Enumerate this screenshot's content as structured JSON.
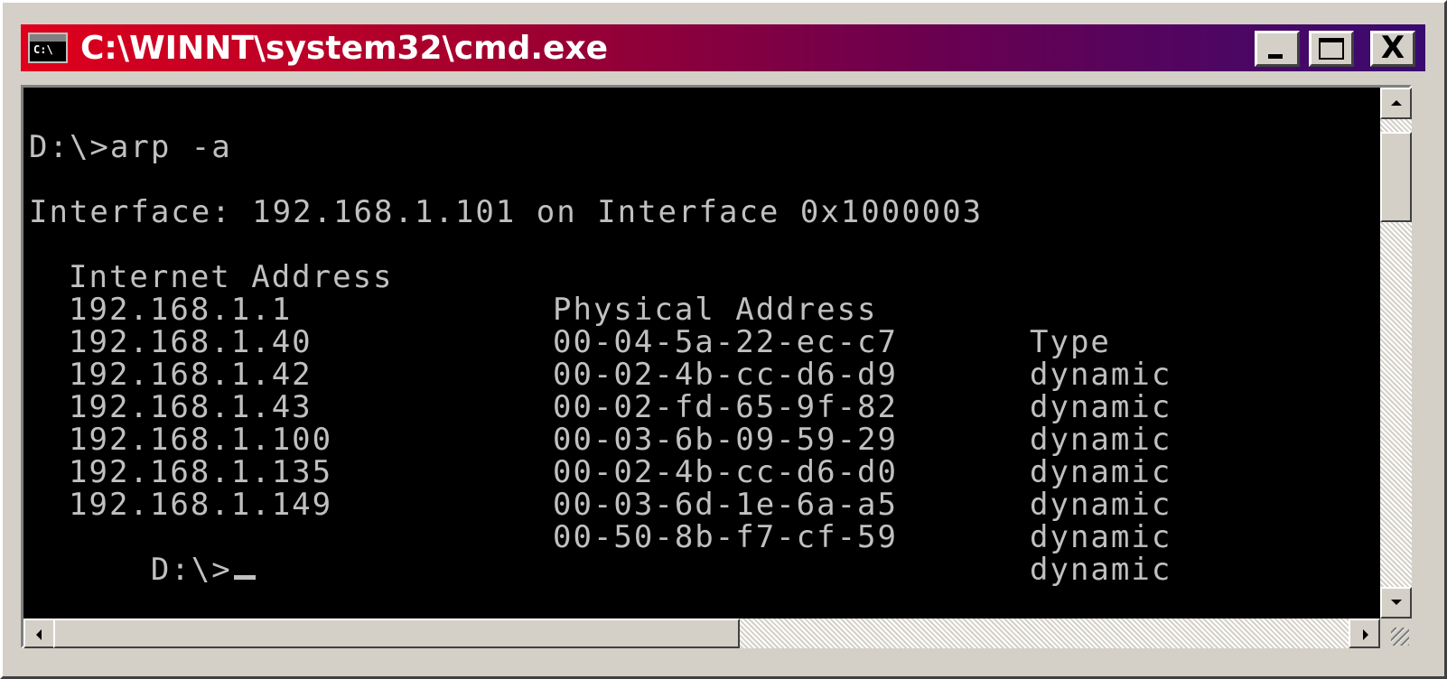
{
  "window": {
    "title": "C:\\WINNT\\system32\\cmd.exe",
    "icon_label": "C:\\"
  },
  "title_buttons": {
    "minimize": "minimize-icon",
    "maximize": "maximize-icon",
    "close_label": "X"
  },
  "console": {
    "command_line": "D:\\>arp -a",
    "interface_line": "Interface: 192.168.1.101 on Interface 0x1000003",
    "headers": [
      "Internet Address",
      "Physical Address",
      "Type"
    ],
    "rows": [
      [
        "192.168.1.1",
        "00-04-5a-22-ec-c7",
        "dynamic"
      ],
      [
        "192.168.1.40",
        "00-02-4b-cc-d6-d9",
        "dynamic"
      ],
      [
        "192.168.1.42",
        "00-02-fd-65-9f-82",
        "dynamic"
      ],
      [
        "192.168.1.43",
        "00-03-6b-09-59-29",
        "dynamic"
      ],
      [
        "192.168.1.100",
        "00-02-4b-cc-d6-d0",
        "dynamic"
      ],
      [
        "192.168.1.135",
        "00-03-6d-1e-6a-a5",
        "dynamic"
      ],
      [
        "192.168.1.149",
        "00-50-8b-f7-cf-59",
        "dynamic"
      ]
    ],
    "prompt": "D:\\>"
  },
  "colors": {
    "titlebar_start": "#e0001b",
    "titlebar_end": "#3a0a70",
    "console_bg": "#000000",
    "console_fg": "#c0c0c0"
  }
}
